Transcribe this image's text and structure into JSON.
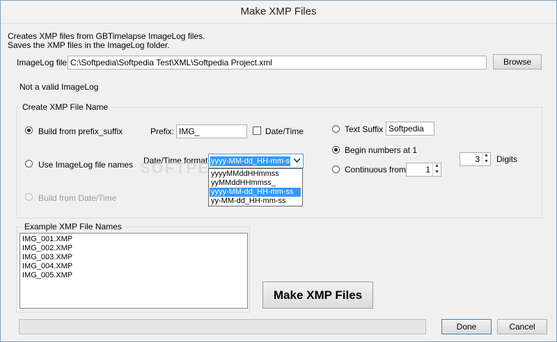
{
  "window": {
    "title": "Make XMP Files"
  },
  "intro": {
    "line1": "Creates XMP files from GBTimelapse ImageLog files.",
    "line2": "Saves the XMP files in the ImageLog folder."
  },
  "imagelog": {
    "label": "ImageLog file",
    "value": "C:\\Softpedia\\Softpedia Test\\XML\\Softpedia Project.xml",
    "browse_label": "Browse",
    "status": "Not a valid ImageLog"
  },
  "name_group": {
    "legend": "Create XMP File Name",
    "option_prefix_suffix": "Build from prefix_suffix",
    "option_imagelog_names": "Use ImageLog file names",
    "option_datetime": "Build from Date/Time",
    "prefix_label": "Prefix:",
    "prefix_value": "IMG_",
    "datetime_check_label": "Date/Time",
    "datetime_format_label": "Date/Time format",
    "datetime_format_value": "yyyy-MM-dd_HH-mm-ss",
    "datetime_options": [
      "yyyyMMddHHmmss",
      "yyMMddHHmmss_",
      "yyyy-MM-dd_HH-mm-ss",
      "yy-MM-dd_HH-mm-ss"
    ],
    "text_suffix_label": "Text Suffix",
    "text_suffix_value": "Softpedia",
    "begin_numbers_label": "Begin numbers at 1",
    "continuous_label": "Continuous from",
    "continuous_value": "1",
    "digits_value": "3",
    "digits_label": "Digits"
  },
  "examples": {
    "legend": "Example XMP File Names",
    "items": [
      "IMG_001.XMP",
      "IMG_002.XMP",
      "IMG_003.XMP",
      "IMG_004.XMP",
      "IMG_005.XMP"
    ]
  },
  "actions": {
    "make_label": "Make XMP Files",
    "done_label": "Done",
    "cancel_label": "Cancel"
  },
  "watermark": "SOFTPEDIA",
  "colors": {
    "selection": "#3399ff",
    "close_button": "#c75050"
  }
}
